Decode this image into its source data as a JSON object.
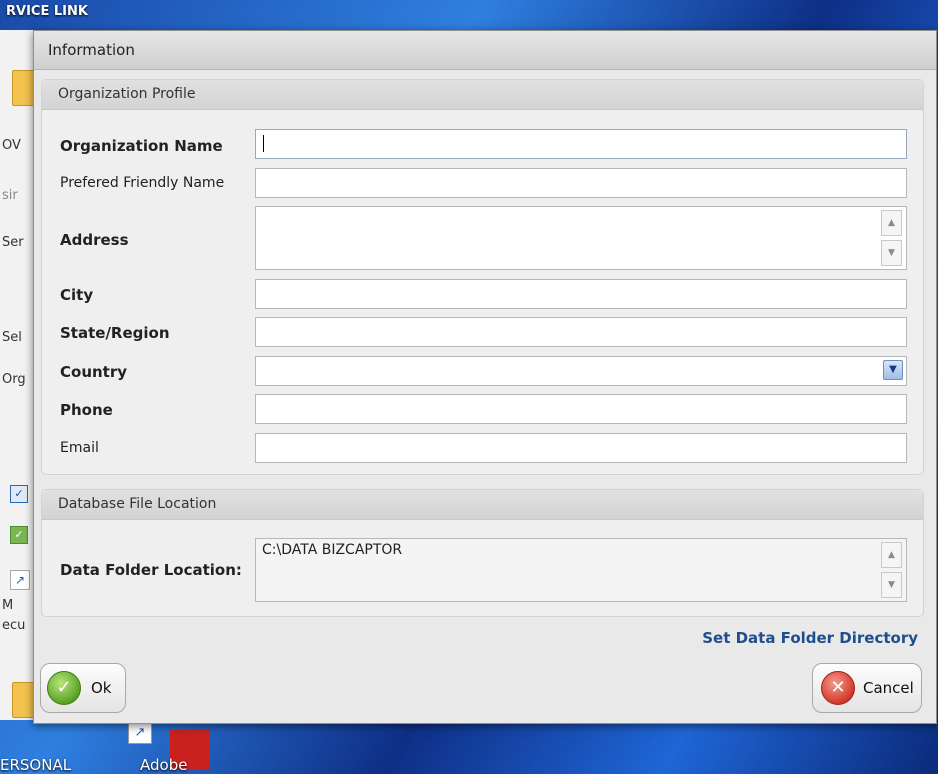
{
  "desktop": {
    "window_title_fragment": "RVICE LINK",
    "left_fragments": [
      "OV",
      "sir",
      "Ser",
      "Sel",
      "Org",
      "M",
      "ecu"
    ],
    "taskbar_labels": [
      "ERSONAL",
      "Adobe"
    ]
  },
  "dialog": {
    "title": "Information",
    "organization_profile": {
      "header": "Organization Profile",
      "fields": {
        "organization_name": {
          "label": "Organization Name",
          "value": ""
        },
        "friendly_name": {
          "label": "Prefered Friendly Name",
          "value": ""
        },
        "address": {
          "label": "Address",
          "value": ""
        },
        "city": {
          "label": "City",
          "value": ""
        },
        "state_region": {
          "label": "State/Region",
          "value": ""
        },
        "country": {
          "label": "Country",
          "value": ""
        },
        "phone": {
          "label": "Phone",
          "value": ""
        },
        "email": {
          "label": "Email",
          "value": ""
        }
      }
    },
    "database": {
      "header": "Database File Location",
      "data_folder_label": "Data Folder Location:",
      "data_folder_value": "C:\\DATA BIZCAPTOR"
    },
    "set_folder_link": "Set Data Folder Directory",
    "buttons": {
      "ok_label": "Ok",
      "cancel_label": "Cancel"
    },
    "icons": {
      "ok": "checkmark-icon",
      "cancel": "close-x-icon",
      "scroll_up": "arrow-up-icon",
      "scroll_down": "arrow-down-icon",
      "dropdown": "chevron-down-icon"
    },
    "colors": {
      "link": "#1f4e8c",
      "ok_icon": "#58a325",
      "cancel_icon": "#d23a2a"
    }
  }
}
